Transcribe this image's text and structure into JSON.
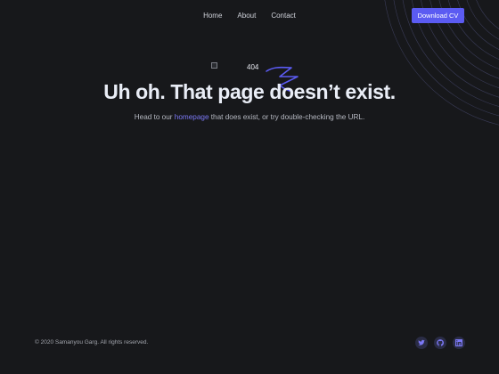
{
  "nav": {
    "items": [
      {
        "label": "Home"
      },
      {
        "label": "About"
      },
      {
        "label": "Contact"
      }
    ],
    "cta_label": "Download CV"
  },
  "hero": {
    "image_alt": "404",
    "title": "Uh oh. That page doesn’t exist.",
    "subtitle_before": "Head to our ",
    "subtitle_link": "homepage",
    "subtitle_after": " that does exist, or try double-checking the URL."
  },
  "footer": {
    "copyright": "© 2020 Samanyou Garg. All rights reserved.",
    "social": [
      {
        "icon": "twitter-icon"
      },
      {
        "icon": "github-icon"
      },
      {
        "icon": "linkedin-icon"
      }
    ]
  },
  "colors": {
    "background": "#17181b",
    "accent": "#5b5bf2",
    "link": "#7b78f5",
    "text": "#e9edf6",
    "muted": "#b7bac3"
  }
}
